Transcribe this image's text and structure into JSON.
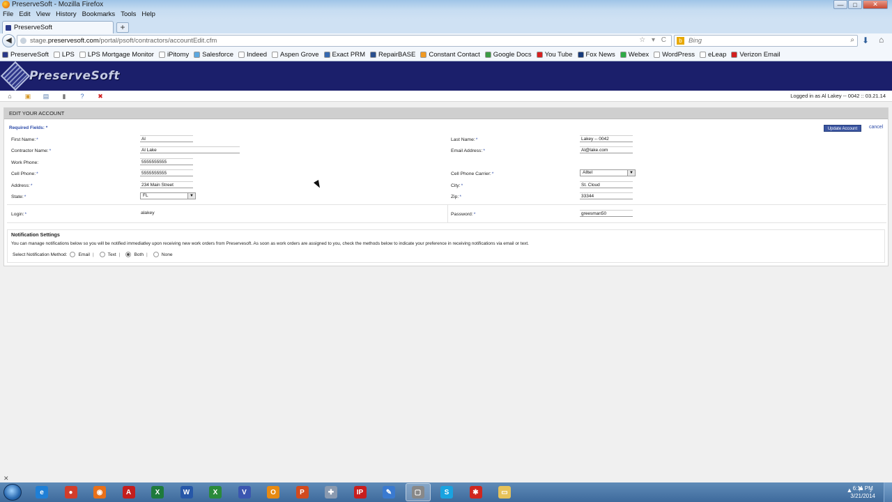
{
  "window": {
    "title": "PreserveSoft - Mozilla Firefox",
    "controls": {
      "minimize": "—",
      "maximize": "□",
      "close": "✕"
    }
  },
  "menu": [
    "File",
    "Edit",
    "View",
    "History",
    "Bookmarks",
    "Tools",
    "Help"
  ],
  "tab": {
    "title": "PreserveSoft",
    "new_tab": "+"
  },
  "nav": {
    "back": "◀",
    "url_prefix": "stage.",
    "url_domain": "preservesoft.com",
    "url_path": "/portal/psoft/contractors/accountEdit.cfm",
    "url_controls": "☆ ▾ C",
    "search_placeholder": "Bing",
    "search_engine_icon": "b",
    "search_icon": "⌕",
    "download_icon": "⬇",
    "home_icon": "⌂"
  },
  "bookmarks": [
    {
      "label": "PreserveSoft",
      "color": "#2b3a8a"
    },
    {
      "label": "LPS",
      "color": "#ffffff"
    },
    {
      "label": "LPS Mortgage Monitor",
      "color": "#ffffff"
    },
    {
      "label": "iPitomy",
      "color": "#ffffff"
    },
    {
      "label": "Salesforce",
      "color": "#5aa7e0"
    },
    {
      "label": "Indeed",
      "color": "#ffffff"
    },
    {
      "label": "Aspen Grove",
      "color": "#ffffff"
    },
    {
      "label": "Exact PRM",
      "color": "#3468b0"
    },
    {
      "label": "RepairBASE",
      "color": "#2a4f8e"
    },
    {
      "label": "Constant Contact",
      "color": "#f29a22"
    },
    {
      "label": "Google Docs",
      "color": "#3b9b44"
    },
    {
      "label": "You Tube",
      "color": "#d62020"
    },
    {
      "label": "Fox News",
      "color": "#163a7a"
    },
    {
      "label": "Webex",
      "color": "#2eaa46"
    },
    {
      "label": "WordPress",
      "color": "#ffffff"
    },
    {
      "label": "eLeap",
      "color": "#ffffff"
    },
    {
      "label": "Verizon Email",
      "color": "#d21f1f"
    }
  ],
  "app": {
    "logo_text": "PreserveSoft",
    "toolbar_icons": [
      {
        "name": "home-icon",
        "glyph": "⌂",
        "color": "#444"
      },
      {
        "name": "folder-icon",
        "glyph": "▣",
        "color": "#d79a2b"
      },
      {
        "name": "list-icon",
        "glyph": "▤",
        "color": "#5d7fb0"
      },
      {
        "name": "document-icon",
        "glyph": "▮",
        "color": "#777"
      },
      {
        "name": "help-icon",
        "glyph": "?",
        "color": "#3b6cc0"
      },
      {
        "name": "close-icon",
        "glyph": "✖",
        "color": "#d01f1f"
      }
    ],
    "logged_in_text": "Logged in as Al Lakey -- 0042  ::  03.21.14"
  },
  "form": {
    "section_title": "EDIT YOUR ACCOUNT",
    "required_label": "Required Fields:",
    "required_marker": "*",
    "update_button": "Update Account",
    "cancel_link": "cancel",
    "labels": {
      "first_name": "First Name:",
      "contractor_name": "Contractor Name:",
      "work_phone": "Work Phone:",
      "cell_phone": "Cell Phone:",
      "address": "Address:",
      "state": "State:",
      "login": "Login:",
      "last_name": "Last Name:",
      "email": "Email Address:",
      "cell_carrier": "Cell Phone Carrier:",
      "city": "City:",
      "zip": "Zip:",
      "password": "Password:"
    },
    "values": {
      "first_name": "Al",
      "contractor_name": "Al Lake",
      "work_phone": "5555555555",
      "cell_phone": "5555555555",
      "address": "234 Main Street",
      "state": "FL",
      "login": "alakey",
      "last_name": "Lakey -- 0042",
      "email": "Al@lake.com",
      "cell_carrier": "Alltel",
      "city": "St. Cloud",
      "zip": "33344",
      "password": "greesman50"
    }
  },
  "notifications": {
    "title": "Notification Settings",
    "description": "You can manage notifications below so you will be notified immediatley upon receiving new work orders from Preservesoft. As soon as work orders are assigned to you, check the methods below to indicate your preference in receiving notifications via email or text.",
    "select_label": "Select Notification Method:",
    "options": [
      "Email",
      "Text",
      "Both",
      "None"
    ],
    "selected": "Both"
  },
  "status": {
    "close_glyph": "✕"
  },
  "taskbar": {
    "apps": [
      {
        "name": "internet-explorer",
        "glyph": "e",
        "color": "#1f7fd6"
      },
      {
        "name": "chrome",
        "glyph": "●",
        "color": "#d23c2a"
      },
      {
        "name": "firefox",
        "glyph": "◉",
        "color": "#e8701a"
      },
      {
        "name": "acrobat",
        "glyph": "A",
        "color": "#c41e1e"
      },
      {
        "name": "excel",
        "glyph": "X",
        "color": "#1e7a3c"
      },
      {
        "name": "word",
        "glyph": "W",
        "color": "#2657a8"
      },
      {
        "name": "excel-2",
        "glyph": "X",
        "color": "#2a8a3a"
      },
      {
        "name": "visio",
        "glyph": "V",
        "color": "#3a56b0"
      },
      {
        "name": "outlook",
        "glyph": "O",
        "color": "#e88a12"
      },
      {
        "name": "powerpoint",
        "glyph": "P",
        "color": "#d24a1e"
      },
      {
        "name": "pin-app",
        "glyph": "✚",
        "color": "#8a9ab0"
      },
      {
        "name": "ip-app",
        "glyph": "IP",
        "color": "#c81e1e"
      },
      {
        "name": "pen-app",
        "glyph": "✎",
        "color": "#3a7ad0"
      },
      {
        "name": "window-app",
        "glyph": "▢",
        "color": "#888888"
      },
      {
        "name": "skype",
        "glyph": "S",
        "color": "#19a3e0"
      },
      {
        "name": "splash-app",
        "glyph": "✱",
        "color": "#d0261e"
      },
      {
        "name": "explorer",
        "glyph": "▭",
        "color": "#e6c25a"
      }
    ],
    "tray_icons": [
      "▲",
      "⚑",
      "♪"
    ],
    "time": "6:11 PM",
    "date": "3/21/2014"
  }
}
